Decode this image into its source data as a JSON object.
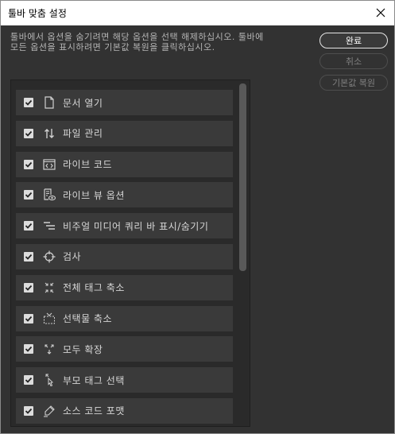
{
  "dialog": {
    "title": "툴바 맞춤 설정",
    "instructions": "툴바에서 옵션을 숨기려면 해당 옵션을 선택 해제하십시오. 툴바에 모든 옵션을 표시하려면 기본값 복원을 클릭하십시오."
  },
  "buttons": {
    "done": "완료",
    "cancel": "취소",
    "restore_defaults": "기본값 복원"
  },
  "colors": {
    "background": "#323232",
    "panel": "#2a2a2a",
    "item": "#3a3a3a",
    "text": "#d6d6d6"
  },
  "items": [
    {
      "label": "문서 열기",
      "checked": true,
      "icon": "document-icon"
    },
    {
      "label": "파일 관리",
      "checked": true,
      "icon": "file-transfer-icon"
    },
    {
      "label": "라이브 코드",
      "checked": true,
      "icon": "live-code-icon"
    },
    {
      "label": "라이브 뷰 옵션",
      "checked": true,
      "icon": "live-view-options-icon"
    },
    {
      "label": "비주얼 미디어 쿼리 바 표시/숨기기",
      "checked": true,
      "icon": "media-query-bar-icon"
    },
    {
      "label": "검사",
      "checked": true,
      "icon": "inspect-icon"
    },
    {
      "label": "전체 태그 축소",
      "checked": true,
      "icon": "collapse-all-icon"
    },
    {
      "label": "선택물 축소",
      "checked": true,
      "icon": "collapse-selection-icon"
    },
    {
      "label": "모두 확장",
      "checked": true,
      "icon": "expand-all-icon"
    },
    {
      "label": "부모 태그 선택",
      "checked": true,
      "icon": "select-parent-tag-icon"
    },
    {
      "label": "소스 코드 포맷",
      "checked": true,
      "icon": "format-source-icon"
    }
  ]
}
